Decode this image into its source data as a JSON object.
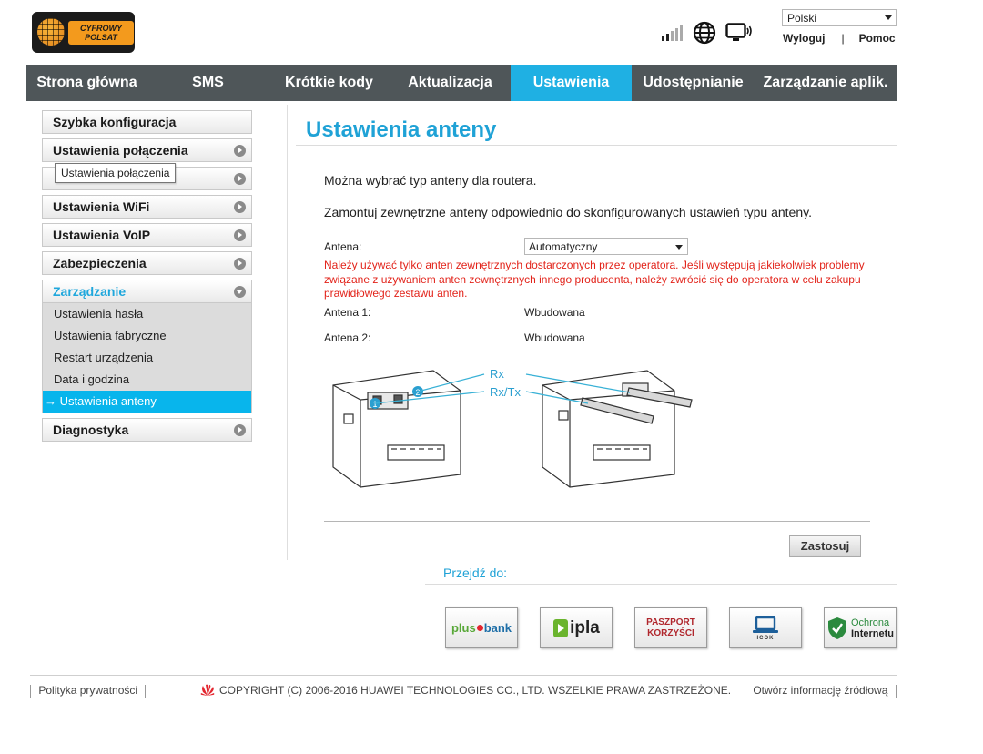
{
  "header": {
    "logo": {
      "line1": "CYFROWY",
      "line2": "POLSAT"
    },
    "language": {
      "selected": "Polski"
    },
    "links": {
      "logout": "Wyloguj",
      "separator": "|",
      "help": "Pomoc"
    },
    "status": {
      "signal_bars": 2,
      "signal_max": 5
    }
  },
  "nav": {
    "items": [
      {
        "label": "Strona główna"
      },
      {
        "label": "SMS"
      },
      {
        "label": "Krótkie kody"
      },
      {
        "label": "Aktualizacja"
      },
      {
        "label": "Ustawienia"
      },
      {
        "label": "Udostępnianie"
      },
      {
        "label": "Zarządzanie aplik."
      }
    ],
    "active_index": 4,
    "active_color": "#1fb0e3"
  },
  "sidebar": {
    "items": [
      {
        "label": "Szybka konfiguracja"
      },
      {
        "label": "Ustawienia połączenia"
      },
      {
        "label": ""
      },
      {
        "label": "Ustawienia WiFi"
      },
      {
        "label": "Ustawienia VoIP"
      },
      {
        "label": "Zabezpieczenia"
      },
      {
        "label": "Zarządzanie"
      },
      {
        "label": "Diagnostyka"
      }
    ],
    "submenu": [
      {
        "label": "Ustawienia hasła"
      },
      {
        "label": "Ustawienia fabryczne"
      },
      {
        "label": "Restart urządzenia"
      },
      {
        "label": "Data i godzina"
      },
      {
        "label": "Ustawienia anteny"
      }
    ],
    "active_submenu_arrow": "→",
    "tooltip": "Ustawienia połączenia"
  },
  "main": {
    "title": "Ustawienia anteny",
    "desc1": "Można wybrać typ anteny dla routera.",
    "desc2": "Zamontuj zewnętrzne anteny odpowiednio do skonfigurowanych ustawień typu anteny.",
    "antenna_label": "Antena:",
    "antenna_value": "Automatyczny",
    "warning": "Należy używać tylko anten zewnętrznych dostarczonych przez operatora. Jeśli występują jakiekolwiek problemy związane z używaniem anten zewnętrznych innego producenta, należy zwrócić się do operatora w celu zakupu prawidłowego zestawu anten.",
    "antenna1_label": "Antena 1:",
    "antenna1_value": "Wbudowana",
    "antenna2_label": "Antena 2:",
    "antenna2_value": "Wbudowana",
    "diagram": {
      "rx": "Rx",
      "rxtx": "Rx/Tx",
      "port1": "1",
      "port2": "2"
    },
    "apply": "Zastosuj"
  },
  "goto": {
    "label": "Przejdź do:",
    "tiles": {
      "plus_bank": {
        "left": "plus",
        "right": "bank"
      },
      "ipla": "ipla",
      "paszport": {
        "line1": "PASZPORT",
        "line2": "KORZYŚCI"
      },
      "icok": "ICOK",
      "ochrona": {
        "line1": "Ochrona",
        "line2": "Internetu"
      }
    }
  },
  "footer": {
    "privacy": "Polityka prywatności",
    "copyright": "COPYRIGHT (C) 2006-2016 HUAWEI TECHNOLOGIES CO., LTD. WSZELKIE PRAWA ZASTRZEŻONE.",
    "opensource": "Otwórz informację źródłową"
  },
  "colors": {
    "accent": "#1fa2d6",
    "nav_bg": "#4f5659",
    "warning": "#e2231a",
    "submenu_active": "#08b5ec"
  }
}
